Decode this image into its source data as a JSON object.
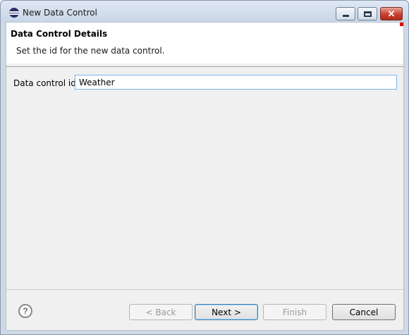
{
  "window": {
    "title": "New Data Control",
    "minimize_icon": "minimize-icon",
    "maximize_icon": "maximize-icon",
    "close_icon": "close-icon",
    "close_glyph": "✕"
  },
  "header": {
    "title": "Data Control Details",
    "description": "Set the id for the new data control."
  },
  "form": {
    "id_label": "Data control id:",
    "id_value": "Weather"
  },
  "footer": {
    "help_glyph": "?",
    "back_label": "< Back",
    "next_label": "Next >",
    "finish_label": "Finish",
    "cancel_label": "Cancel"
  },
  "colors": {
    "accent_focus": "#7eb4ea",
    "close_button": "#c9402d",
    "status_marker": "#e00000"
  }
}
